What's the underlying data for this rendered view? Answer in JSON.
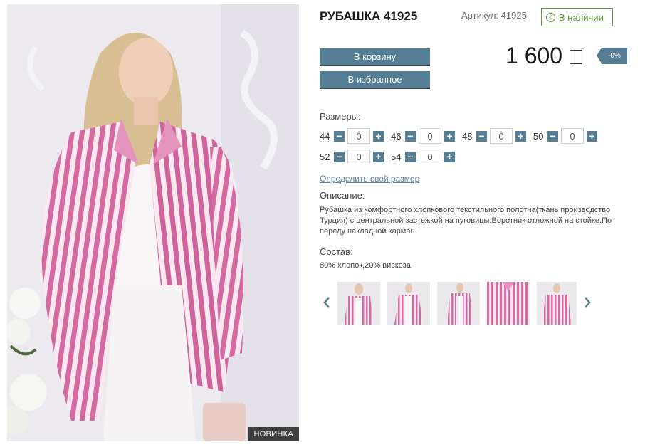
{
  "product": {
    "title": "РУБАШКА 41925",
    "sku_label": "Артикул: 41925",
    "stock_label": "В наличии",
    "price": "1 600",
    "discount": "-0%",
    "badge": "НОВИНКА"
  },
  "buttons": {
    "cart": "В корзину",
    "favorite": "В избранное"
  },
  "sizes": {
    "label": "Размеры:",
    "row1": [
      {
        "size": "44",
        "qty": "0"
      },
      {
        "size": "46",
        "qty": "0"
      },
      {
        "size": "48",
        "qty": "0"
      },
      {
        "size": "50",
        "qty": "0"
      }
    ],
    "row2": [
      {
        "size": "52",
        "qty": "0"
      },
      {
        "size": "54",
        "qty": "0"
      }
    ],
    "link": "Определить свой размер"
  },
  "description": {
    "label": "Описание:",
    "text": "Рубашка из комфортного хлопкового текстильного полотна(ткань производство Турция) с центральной застежкой на пуговицы.Воротник отложной на стойке.По переду накладной карман."
  },
  "composition": {
    "label": "Состав:",
    "text": "80% хлопок,20% вискоза"
  },
  "colors": {
    "accent": "#557d93",
    "stock": "#5b9a3a",
    "link": "#5b85a8",
    "shirt_pink": "#d56aa0"
  }
}
